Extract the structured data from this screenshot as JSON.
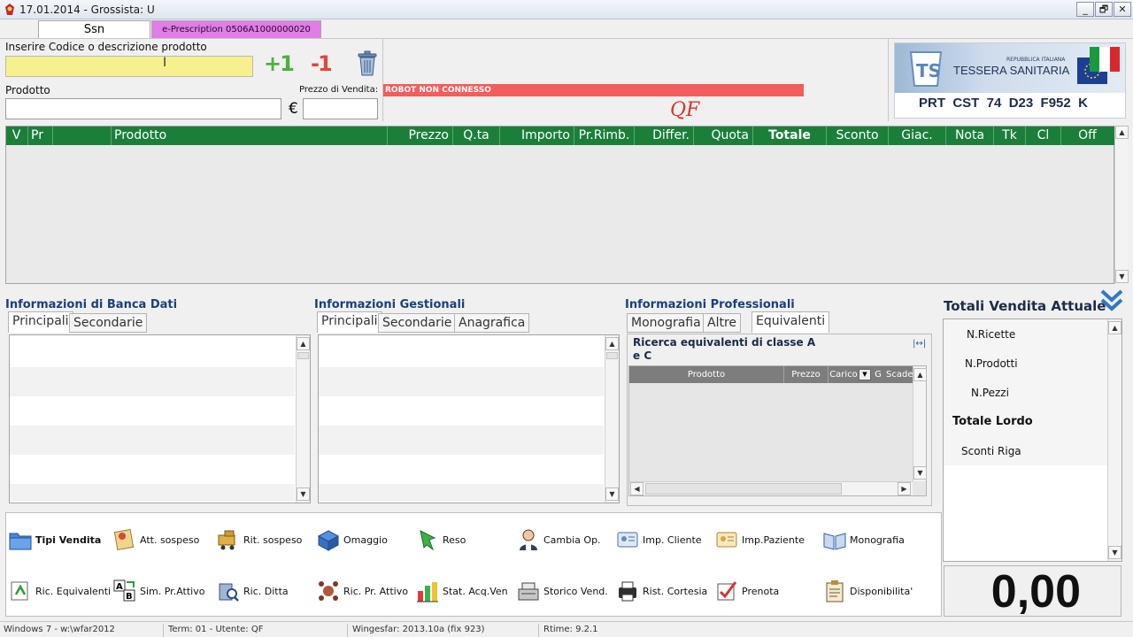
{
  "window": {
    "title": "17.01.2014 - Grossista: U",
    "minimize": "_",
    "restore": "🗗",
    "close": "✕"
  },
  "tabs": {
    "ssn": "Ssn",
    "eprescription": "e-Prescription 0506A1000000020"
  },
  "search": {
    "label": "Inserire Codice o descrizione prodotto",
    "value": ""
  },
  "product": {
    "label": "Prodotto",
    "value": "",
    "price_label": "Prezzo di Vendita:",
    "currency": "€",
    "price_value": ""
  },
  "actions": {
    "plus_one": "+1",
    "minus_one": "-1"
  },
  "robot_status": "ROBOT NON CONNESSO",
  "operator_tag": "QF",
  "tessera": {
    "line1": "REPUBBLICA ITALIANA",
    "line2": "TESSERA SANITARIA",
    "code": "PRT  CST  74  D23  F952  K"
  },
  "grid": {
    "columns": [
      "V",
      "Pr",
      "Prodotto",
      "Prezzo",
      "Q.ta",
      "Importo",
      "Pr.Rimb.",
      "Differ.",
      "Quota",
      "Totale",
      "Sconto",
      "Giac.",
      "Nota",
      "Tk",
      "Cl",
      "Off"
    ]
  },
  "banca_dati": {
    "title": "Informazioni di Banca Dati",
    "tabs": [
      "Principali",
      "Secondarie"
    ]
  },
  "gestionali": {
    "title": "Informazioni Gestionali",
    "tabs": [
      "Principali",
      "Secondarie",
      "Anagrafica"
    ]
  },
  "professionali": {
    "title": "Informazioni Professionali",
    "tabs": [
      "Monografia",
      "Altre",
      "Equivalenti"
    ],
    "equiv_title_1": "Ricerca equivalenti di classe A",
    "equiv_title_2": "e C",
    "equiv_columns": [
      "Prodotto",
      "Prezzo",
      "Carico",
      "G",
      "Scade"
    ]
  },
  "toolbar_row1": [
    "Tipi Vendita",
    "Att. sospeso",
    "Rit. sospeso",
    "Omaggio",
    "Reso",
    "Cambia Op.",
    "Imp. Cliente",
    "Imp.Paziente",
    "Monografia"
  ],
  "toolbar_row2": [
    "Ric. Equivalenti",
    "Sim. Pr.Attivo",
    "Ric. Ditta",
    "Ric. Pr. Attivo",
    "Stat. Acq.Ven",
    "Storico Vend.",
    "Rist. Cortesia",
    "Prenota",
    "Disponibilita'"
  ],
  "totals": {
    "title": "Totali Vendita Attuale",
    "items": [
      "N.Ricette",
      "N.Prodotti",
      "N.Pezzi",
      "Totale Lordo",
      "Sconti Riga"
    ],
    "amount": "0,00"
  },
  "status": {
    "os": "Windows 7 - w:\\wfar2012",
    "term": "Term: 01 - Utente: QF",
    "version": "Wingesfar: 2013.10a (fix 923)",
    "rtime": "Rtime: 9.2.1"
  },
  "colors": {
    "grid_header": "#1b7f3a",
    "robot_bar": "#f25d5d",
    "eprescription_tab": "#e07de6",
    "search_field": "#f7f08f"
  }
}
